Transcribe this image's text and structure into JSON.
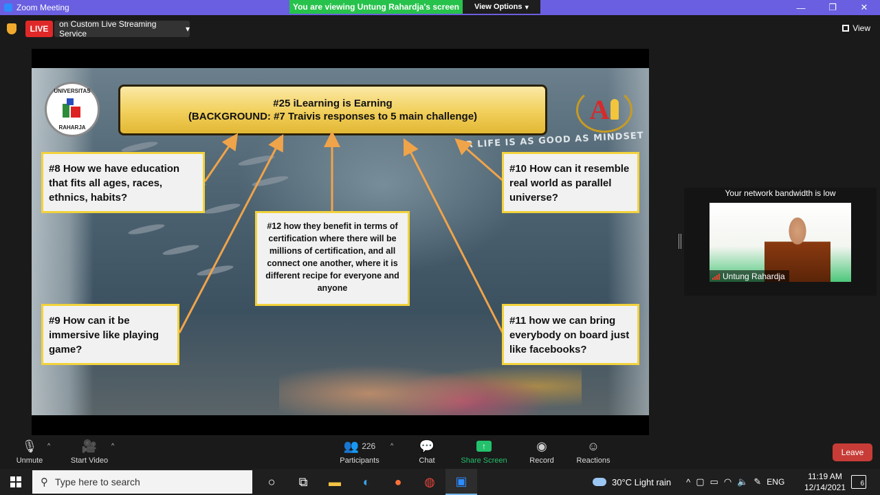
{
  "window": {
    "title": "Zoom Meeting",
    "viewing_banner": "You are viewing Untung Rahardja's screen",
    "view_options_label": "View Options",
    "controls": [
      "—",
      "❐",
      "✕"
    ]
  },
  "topbar": {
    "live_label": "LIVE",
    "stream_label": "on Custom Live Streaming Service",
    "view_label": "View"
  },
  "slide": {
    "title_line1": "#25 iLearning is Earning",
    "title_line2": "(BACKGROUND: #7 Traivis responses to 5 main challenge)",
    "logo_left_text_top": "UNIVERSITAS",
    "logo_left_text_bottom": "RAHARJA",
    "logo_right_letter": "A",
    "overlay_text": "UR LIFE IS AS GOOD AS MINDSET",
    "q8": "#8 How we have education that fits all ages, races, ethnics, habits?",
    "q9": "#9 How can it be immersive like playing game?",
    "q10": "#10 How can it resemble real world as parallel universe?",
    "q11": "#11 how we can bring everybody on board just like facebooks?",
    "q12": "#12 how they benefit in terms of certification where there will be millions of certification, and all connect one another, where it is different recipe for everyone and anyone"
  },
  "participant_panel": {
    "warning": "Your network bandwidth is low",
    "name": "Untung Rahardja"
  },
  "toolbar": {
    "unmute": "Unmute",
    "start_video": "Start Video",
    "participants": "Participants",
    "participants_count": "226",
    "chat": "Chat",
    "share_screen": "Share Screen",
    "record": "Record",
    "reactions": "Reactions",
    "leave": "Leave"
  },
  "taskbar": {
    "search_placeholder": "Type here to search",
    "weather": "30°C  Light rain",
    "language": "ENG",
    "time": "11:19 AM",
    "date": "12/14/2021",
    "notifications": "6"
  },
  "colors": {
    "title_bar": "#6a5fe0",
    "banner_green": "#27c24c",
    "live_red": "#e02828",
    "leave_red": "#c73c37",
    "share_green": "#23c16b",
    "box_border": "#f2d23c",
    "arrow_orange": "#f0a44a"
  }
}
